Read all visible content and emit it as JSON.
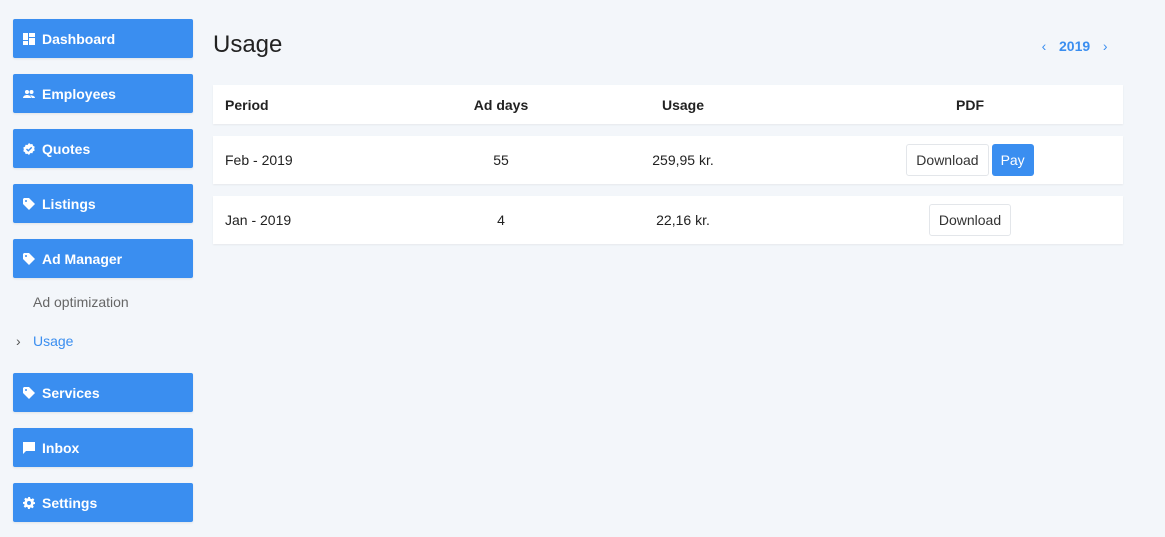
{
  "sidebar": {
    "items": [
      {
        "label": "Dashboard",
        "icon": "dashboard-icon"
      },
      {
        "label": "Employees",
        "icon": "people-icon"
      },
      {
        "label": "Quotes",
        "icon": "check-badge-icon"
      },
      {
        "label": "Listings",
        "icon": "tag-icon"
      },
      {
        "label": "Ad Manager",
        "icon": "tag-icon"
      },
      {
        "label": "Services",
        "icon": "tag-icon"
      },
      {
        "label": "Inbox",
        "icon": "message-icon"
      },
      {
        "label": "Settings",
        "icon": "gear-icon"
      }
    ],
    "subitems": [
      {
        "label": "Ad optimization",
        "active": false
      },
      {
        "label": "Usage",
        "active": true
      }
    ]
  },
  "page": {
    "title": "Usage",
    "year": "2019"
  },
  "table": {
    "headers": {
      "period": "Period",
      "ad_days": "Ad days",
      "usage": "Usage",
      "pdf": "PDF"
    },
    "rows": [
      {
        "period": "Feb - 2019",
        "ad_days": "55",
        "usage": "259,95 kr.",
        "download": "Download",
        "pay": "Pay"
      },
      {
        "period": "Jan - 2019",
        "ad_days": "4",
        "usage": "22,16 kr.",
        "download": "Download"
      }
    ]
  },
  "colors": {
    "accent": "#3a8ef0",
    "background": "#f3f6fa"
  }
}
